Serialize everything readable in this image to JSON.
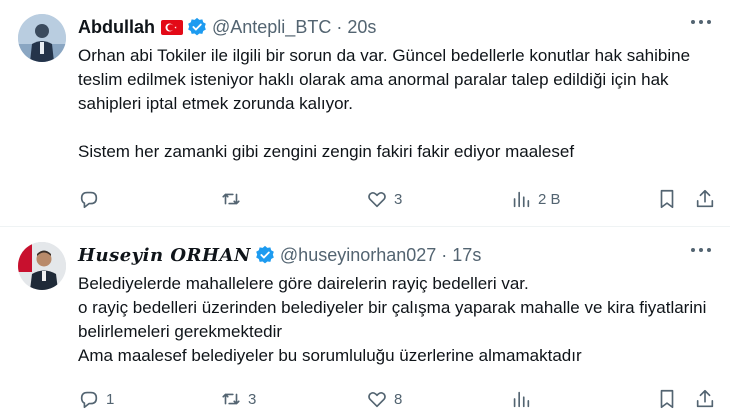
{
  "tweets": [
    {
      "name": "Abdullah",
      "handle": "@Antepli_BTC",
      "time": "20s",
      "body": [
        "Orhan abi Tokiler ile ilgili bir sorun da var. Güncel bedellerle konutlar hak sahibine teslim edilmek isteniyor haklı olarak ama anormal paralar talep edildiği için hak sahipleri iptal etmek zorunda kalıyor.",
        "Sistem her zamanki gibi zengini zengin fakiri fakir ediyor maalesef"
      ],
      "actions": {
        "reply": "",
        "retweet": "",
        "like": "3",
        "views": "2 B"
      }
    },
    {
      "name": "Huseyin ORHAN",
      "handle": "@huseyinorhan027",
      "time": "17s",
      "body": [
        "Belediyelerde mahallelere göre dairelerin rayiç bedelleri var.",
        "o rayiç bedelleri üzerinden belediyeler bir çalışma yaparak mahalle ve kira fiyatlarini belirlemeleri gerekmektedir",
        "Ama maalesef belediyeler bu sorumluluğu üzerlerine almamaktadır"
      ],
      "actions": {
        "reply": "1",
        "retweet": "3",
        "like": "8",
        "views": ""
      }
    }
  ],
  "colors": {
    "verified": "#1d9bf0",
    "muted": "#536471",
    "flag": "#e30a17"
  }
}
